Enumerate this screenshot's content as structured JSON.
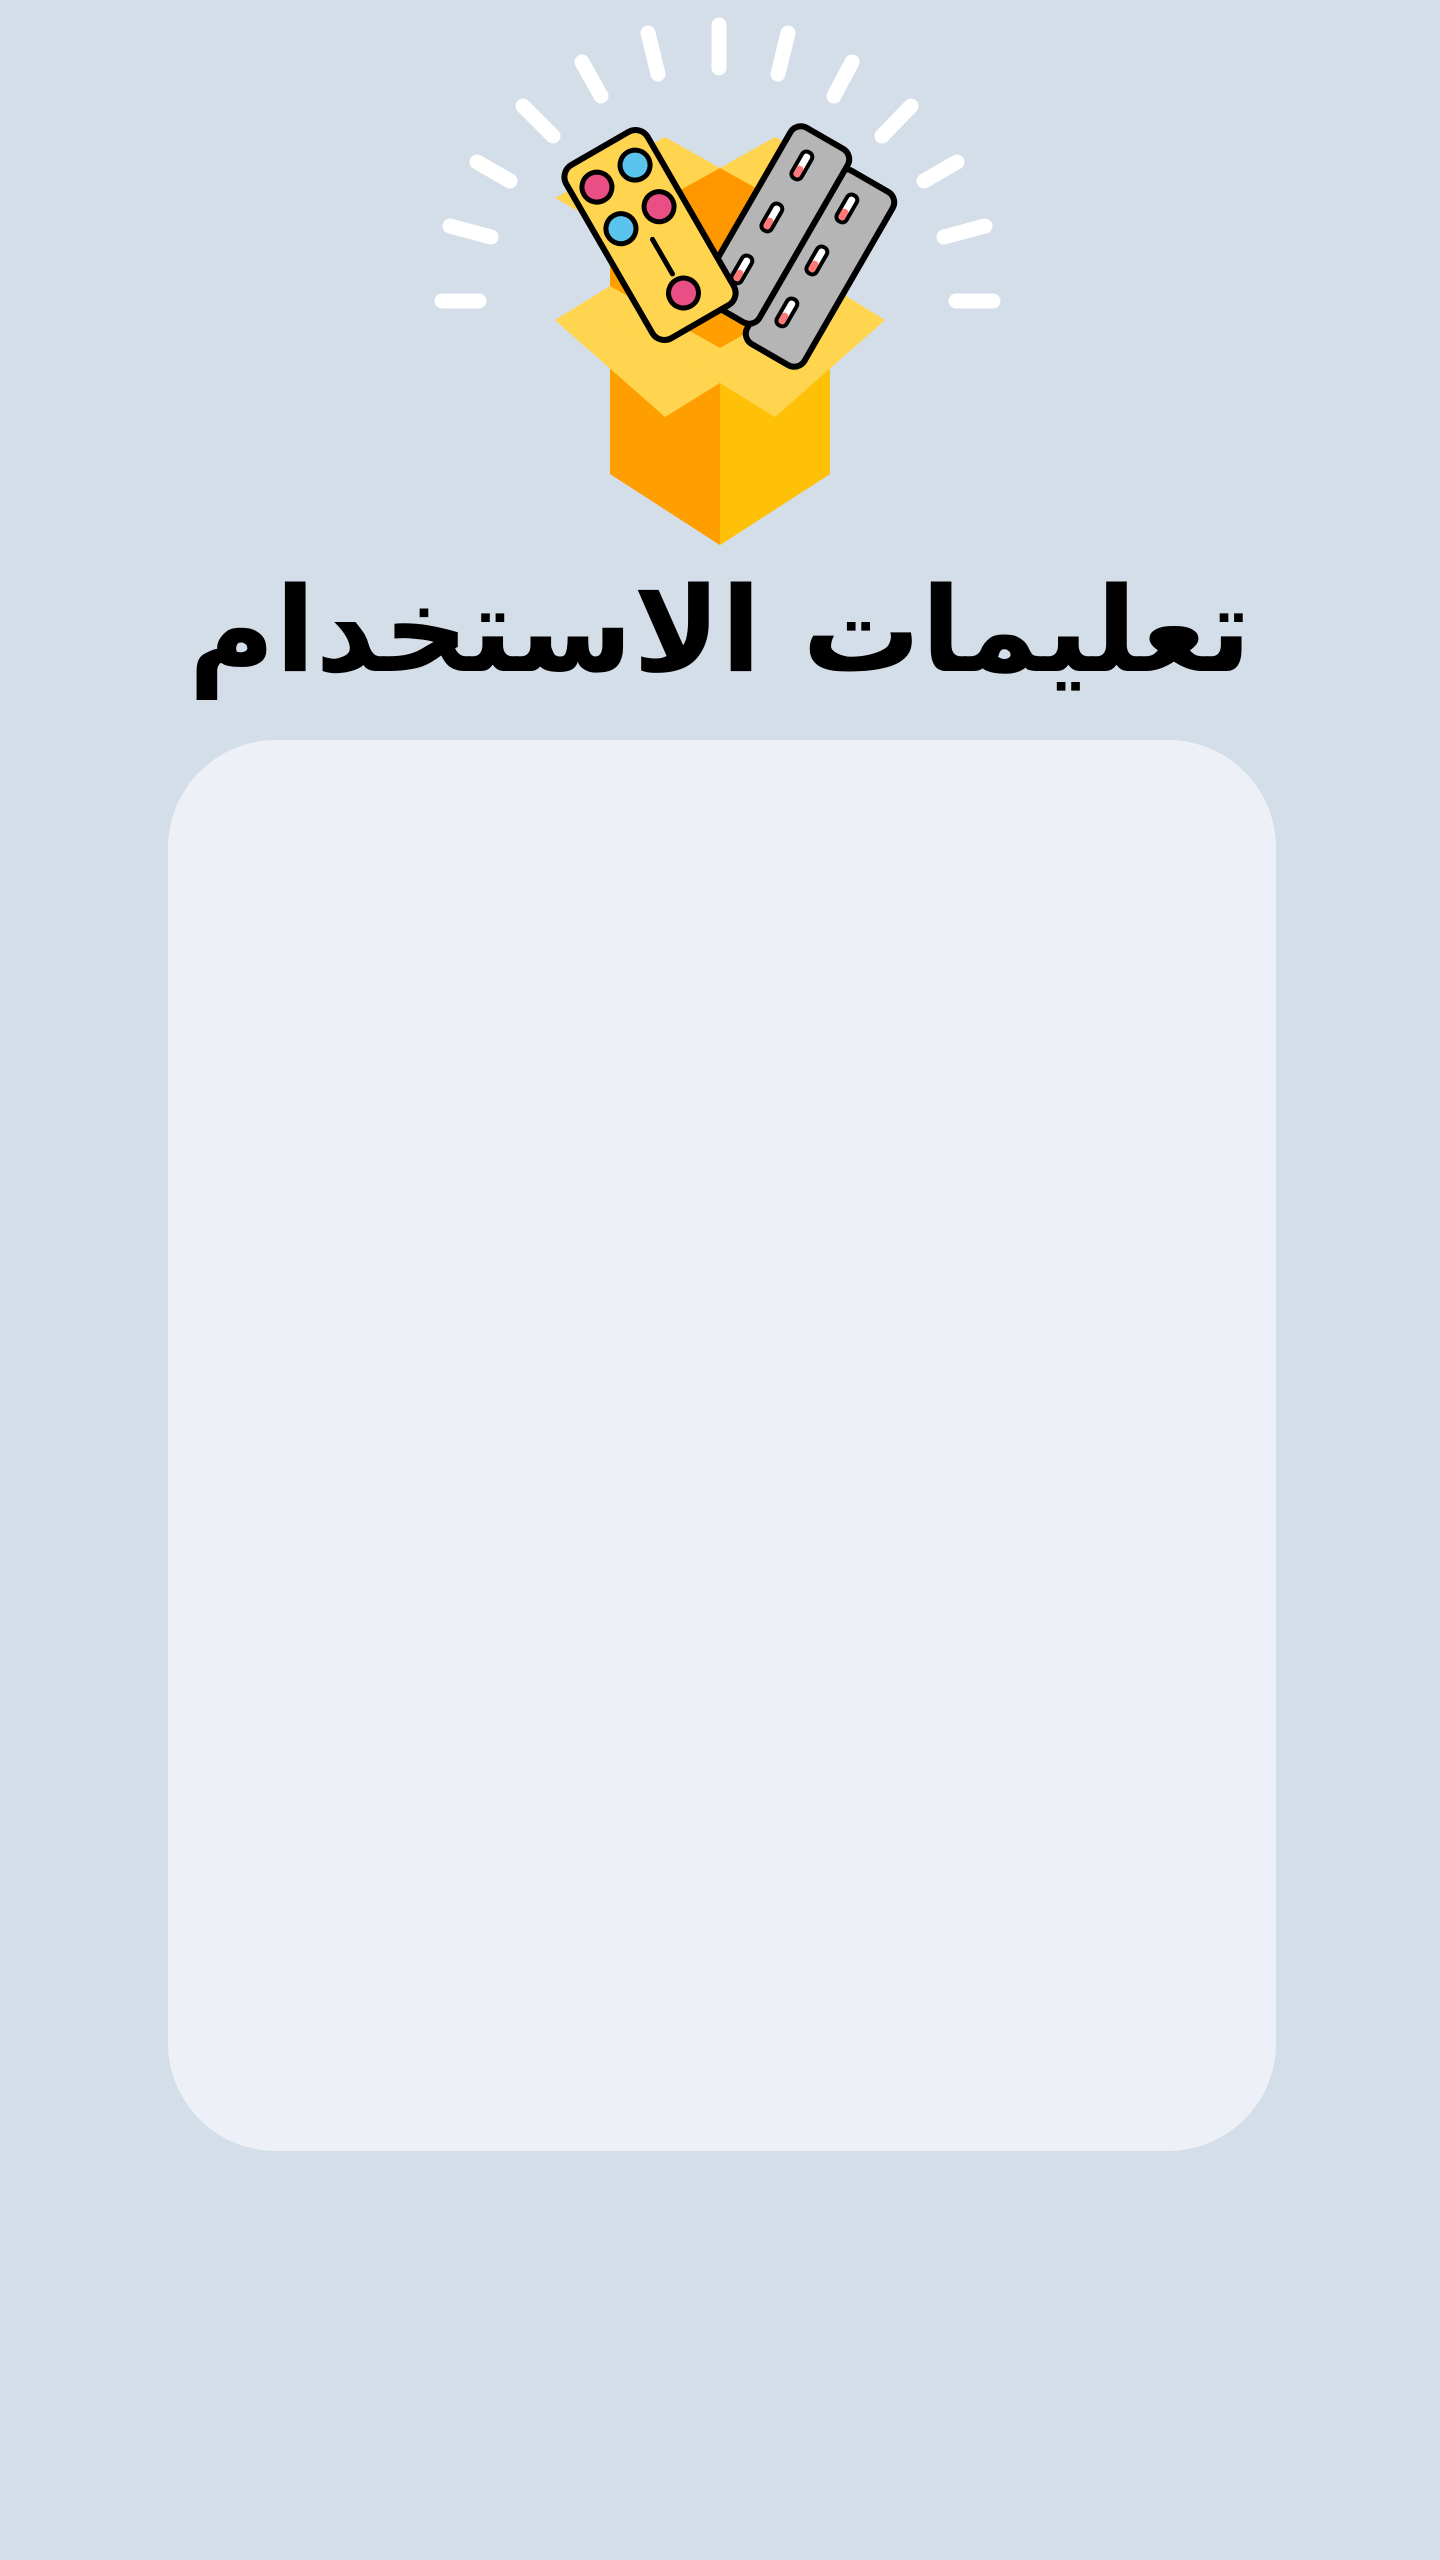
{
  "page": {
    "title": "تعليمات الاستخدام"
  },
  "hero": {
    "icon": "medicine-box-icon"
  },
  "colors": {
    "background": "#d4dee8",
    "card": "#edf1f7",
    "title": "#000000",
    "box_front_left": "#ff9e00",
    "box_front_right": "#ffc107",
    "box_flaps": "#ffd54f",
    "pill_pack_yellow": "#ffd54f",
    "pill_pack_grey": "#b5b5b5",
    "pill_pink": "#e94f84",
    "pill_blue": "#5bc4ee",
    "rays": "#ffffff"
  }
}
